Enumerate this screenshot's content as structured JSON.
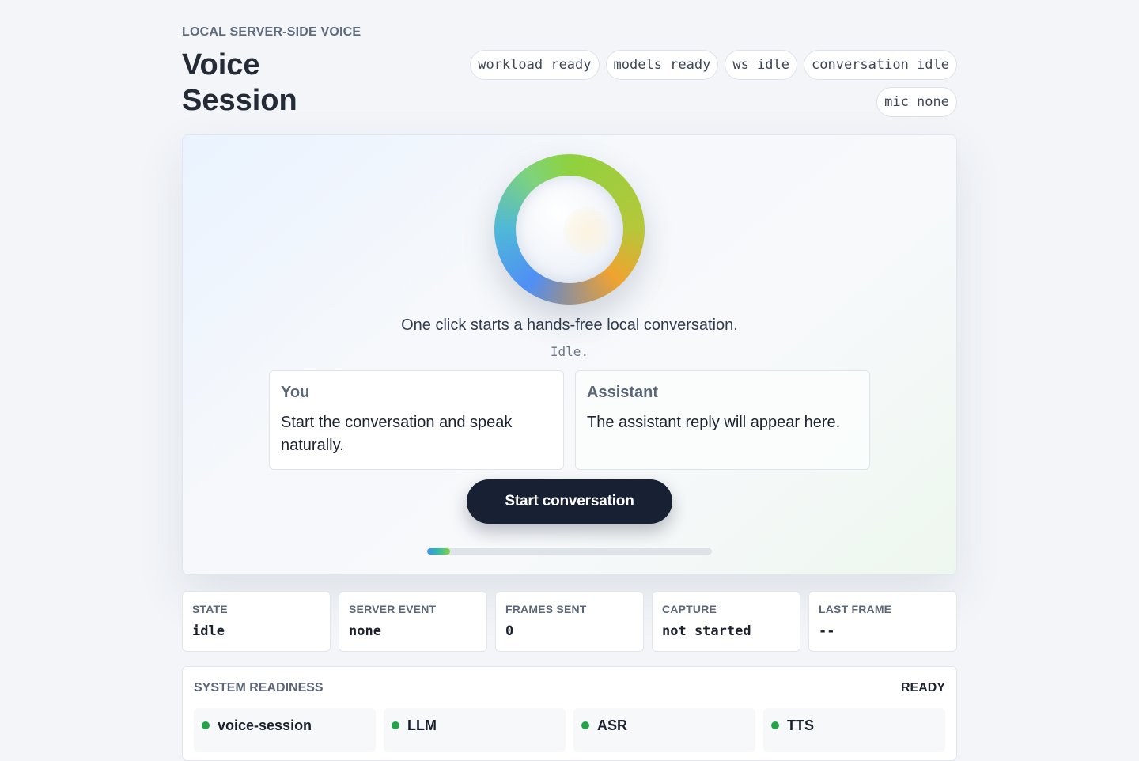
{
  "header": {
    "eyebrow": "LOCAL SERVER-SIDE VOICE",
    "title": "Voice Session"
  },
  "status_pills": [
    "workload ready",
    "models ready",
    "ws idle",
    "conversation idle",
    "mic none"
  ],
  "stage": {
    "lead": "One click starts a hands-free local conversation.",
    "status": "Idle.",
    "you_card": {
      "title": "You",
      "text": "Start the conversation and speak naturally."
    },
    "assistant_card": {
      "title": "Assistant",
      "text": "The assistant reply will appear here."
    },
    "start_button": "Start conversation",
    "progress_fraction": 0.08
  },
  "stats": [
    {
      "label": "STATE",
      "value": "idle"
    },
    {
      "label": "SERVER EVENT",
      "value": "none"
    },
    {
      "label": "FRAMES SENT",
      "value": "0"
    },
    {
      "label": "CAPTURE",
      "value": "not started"
    },
    {
      "label": "LAST FRAME",
      "value": "--"
    }
  ],
  "readiness": {
    "title": "SYSTEM READINESS",
    "badge": "READY",
    "items": [
      "voice-session",
      "LLM",
      "ASR",
      "TTS"
    ],
    "dot_color": "#22a447"
  }
}
